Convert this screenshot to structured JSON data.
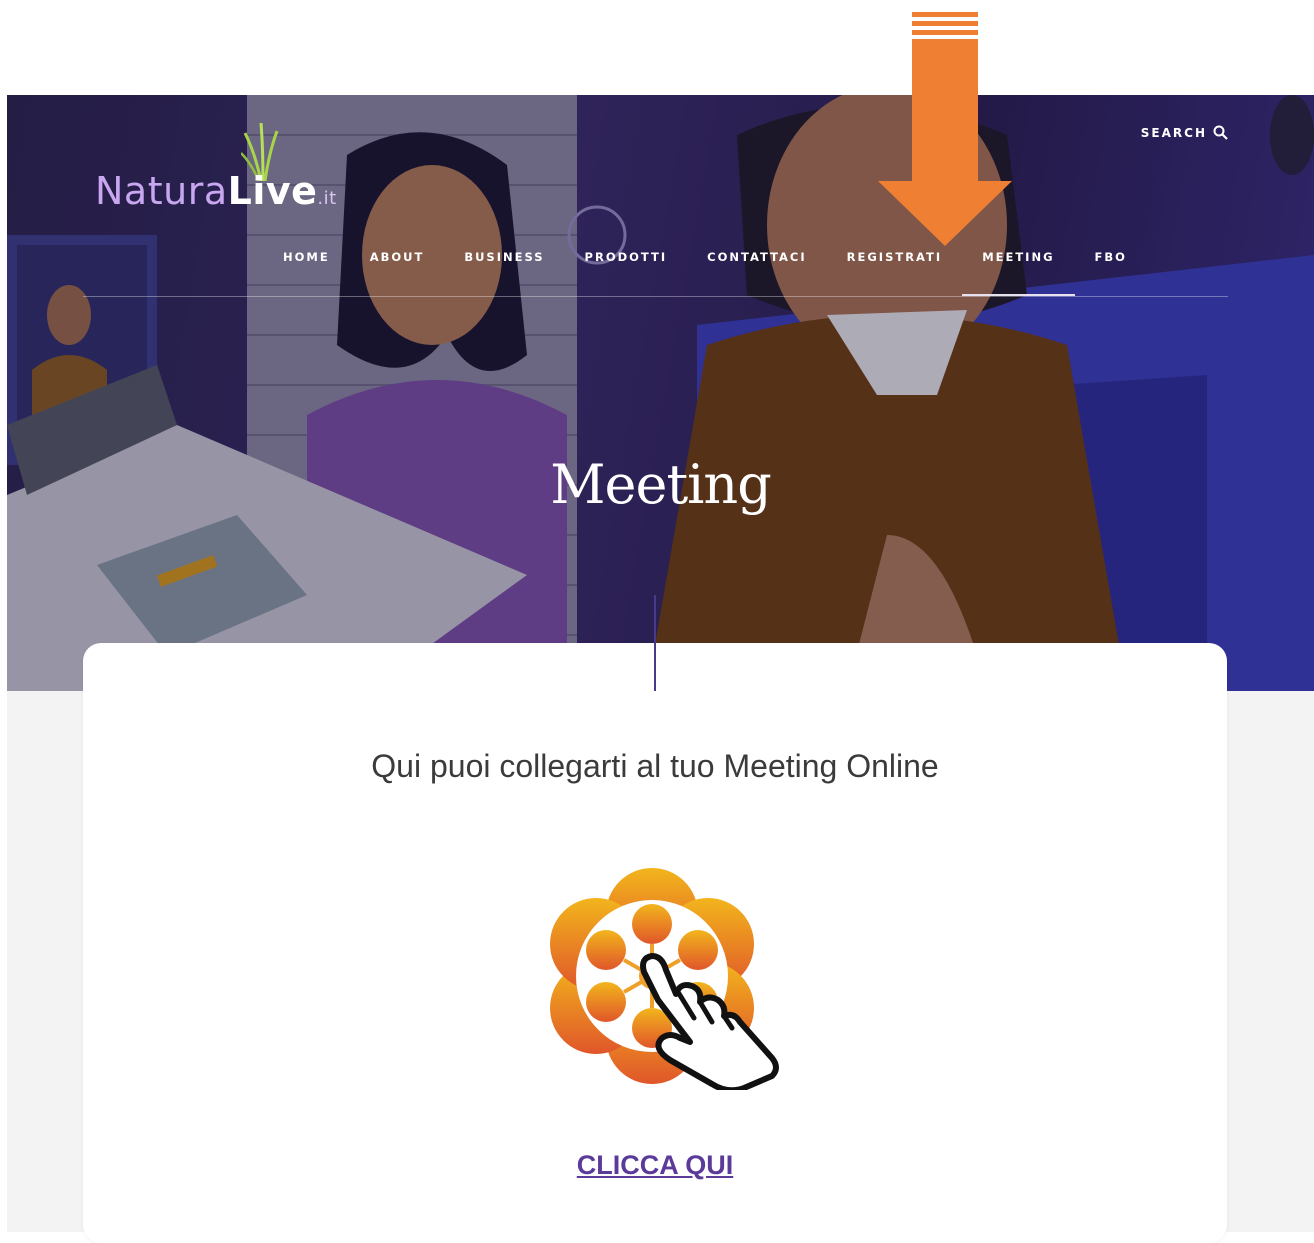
{
  "header": {
    "logo": {
      "part1": "Natura",
      "part2": "Live",
      "part3": ".it"
    },
    "search_label": "SEARCH",
    "nav": [
      {
        "label": "HOME",
        "active": false
      },
      {
        "label": "ABOUT",
        "active": false
      },
      {
        "label": "BUSINESS",
        "active": false
      },
      {
        "label": "PRODOTTI",
        "active": false
      },
      {
        "label": "CONTATTACI",
        "active": false
      },
      {
        "label": "REGISTRATI",
        "active": false
      },
      {
        "label": "MEETING",
        "active": true
      },
      {
        "label": "FBO",
        "active": false
      }
    ]
  },
  "hero": {
    "title": "Meeting"
  },
  "content": {
    "subtitle": "Qui puoi collegarti al tuo Meeting Online",
    "cta_label": "CLICCA QUI"
  },
  "annotation": {
    "arrow_color": "#ee7f33"
  },
  "colors": {
    "accent": "#5b3a99",
    "hero_purple": "#3a2d6e",
    "logo_lilac": "#c8a6f0",
    "grass_green": "#a8d44a"
  }
}
